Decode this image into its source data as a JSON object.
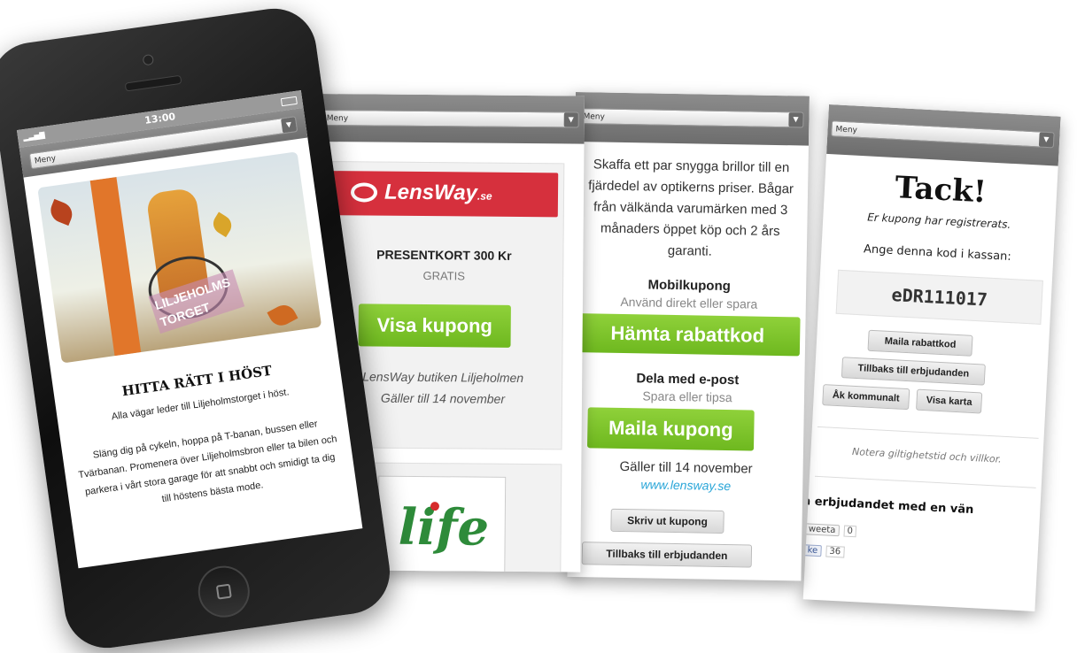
{
  "menu_label": "Meny",
  "phone": {
    "time": "13:00",
    "headline": "HITTA RÄTT I HÖST",
    "intro": "Alla vägar leder till Liljeholmstorget i höst.",
    "body": "Släng dig på cykeln, hoppa på T-banan, bussen eller Tvärbanan. Promenera över Liljeholmsbron eller ta bilen och parkera i vårt stora garage för att snabbt och smidigt ta dig till höstens bästa mode.",
    "banner_text": "LILJEHOLMS TORGET"
  },
  "card1": {
    "logo": "LensWay",
    "logo_suffix": ".se",
    "offer_title": "PRESENTKORT 300 Kr",
    "offer_price": "GRATIS",
    "show_button": "Visa kupong",
    "store": "LensWay butiken Liljeholmen",
    "valid": "Gäller till 14 november",
    "second_logo": "life"
  },
  "card2": {
    "description": "Skaffa ett par snygga brillor till en fjärdedel av optikerns priser. Bågar från välkända varumärken med 3 månaders öppet köp och 2 års garanti.",
    "mobile_title": "Mobilkupong",
    "mobile_sub": "Använd direkt eller spara",
    "fetch_button": "Hämta rabattkod",
    "share_title": "Dela med e-post",
    "share_sub": "Spara eller tipsa",
    "mail_button": "Maila kupong",
    "valid": "Gäller till 14 november",
    "link": "www.lensway.se",
    "print_button": "Skriv ut kupong",
    "back_button": "Tillbaks till erbjudanden"
  },
  "card3": {
    "thanks": "Tack!",
    "registered": "Er kupong har registrerats.",
    "instruction": "Ange denna kod i kassan:",
    "code": "eDR111017",
    "mail_button": "Maila rabattkod",
    "back_button": "Tillbaks till erbjudanden",
    "transit_button": "Åk kommunalt",
    "map_button": "Visa karta",
    "note": "Notera giltighetstid och villkor.",
    "share_heading": "a erbjudandet med en vän",
    "tweet_label": "weeta",
    "tweet_count": "0",
    "like_label": "ke",
    "like_count": "36"
  },
  "colors": {
    "green": "#7cc22a",
    "lensway_red": "#d6303d",
    "link_blue": "#2aa6d8"
  }
}
